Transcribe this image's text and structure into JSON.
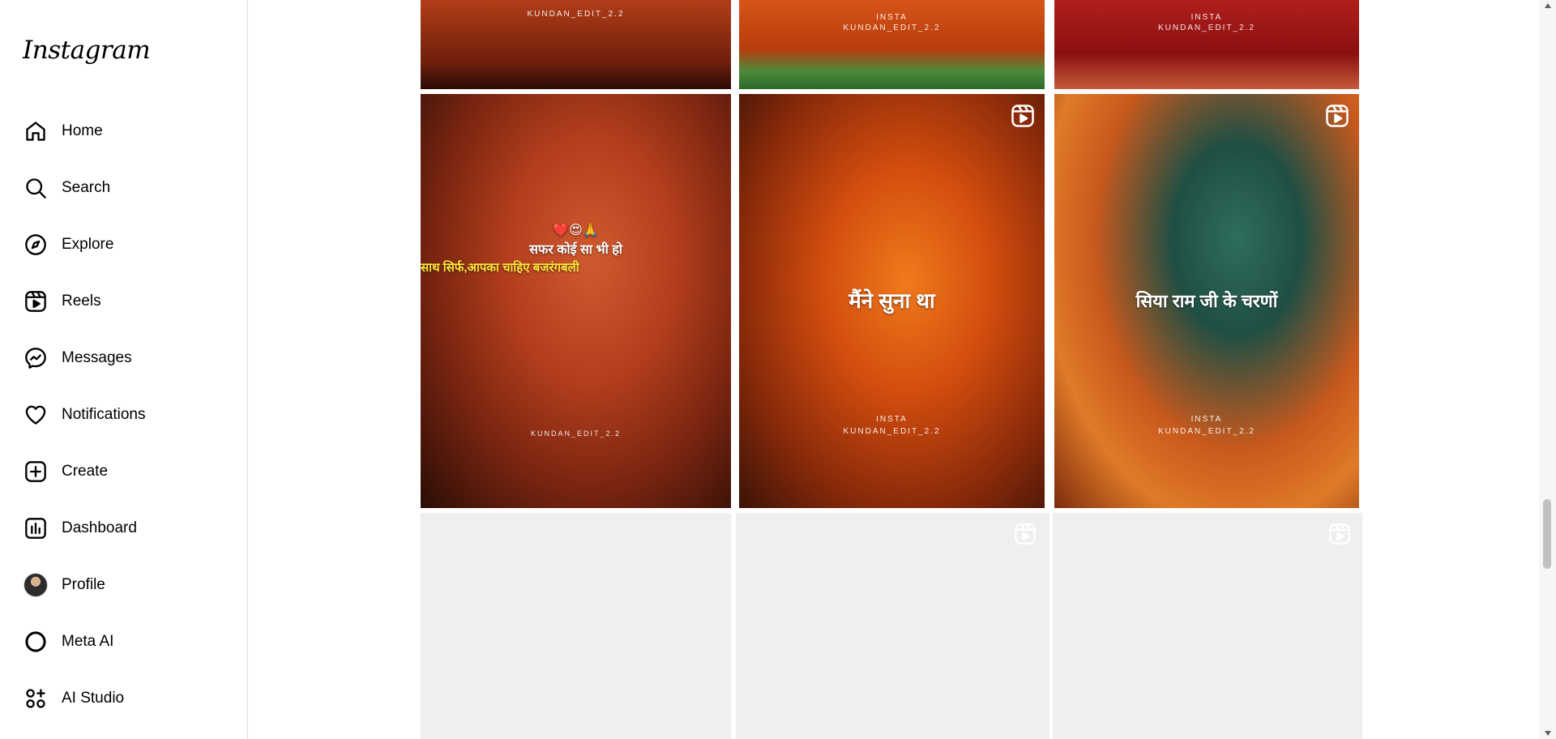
{
  "app": {
    "logo": "Instagram"
  },
  "sidebar": {
    "items": [
      {
        "label": "Home",
        "icon": "home-icon"
      },
      {
        "label": "Search",
        "icon": "search-icon"
      },
      {
        "label": "Explore",
        "icon": "compass-icon"
      },
      {
        "label": "Reels",
        "icon": "reels-icon"
      },
      {
        "label": "Messages",
        "icon": "messenger-icon"
      },
      {
        "label": "Notifications",
        "icon": "heart-icon"
      },
      {
        "label": "Create",
        "icon": "plus-square-icon"
      },
      {
        "label": "Dashboard",
        "icon": "bar-chart-icon"
      },
      {
        "label": "Profile",
        "icon": "avatar"
      },
      {
        "label": "Meta AI",
        "icon": "meta-ai-ring-icon"
      },
      {
        "label": "AI Studio",
        "icon": "ai-studio-icon"
      }
    ]
  },
  "grid": {
    "top_row": [
      {
        "watermark": "KUNDAN_EDIT_2.2"
      },
      {
        "watermark_top": "INSTA",
        "watermark": "KUNDAN_EDIT_2.2"
      },
      {
        "watermark_top": "INSTA",
        "watermark": "KUNDAN_EDIT_2.2"
      }
    ],
    "posts": [
      {
        "emoji": "❤️😍🙏",
        "caption_line1": "सफर कोई सा भी हो",
        "caption_line2": "साथ सिर्फ,आपका चाहिए बजरंगबली",
        "watermark": "KUNDAN_EDIT_2.2",
        "is_reel": false
      },
      {
        "caption": "मैंने सुना था",
        "watermark_top": "INSTA",
        "watermark": "KUNDAN_EDIT_2.2",
        "is_reel": true
      },
      {
        "caption": "सिया राम जी के चरणों",
        "watermark_top": "INSTA",
        "watermark": "KUNDAN_EDIT_2.2",
        "is_reel": true
      }
    ]
  },
  "colors": {
    "accent": "#000000",
    "border": "#dbdbdb",
    "placeholder": "#efefef"
  }
}
